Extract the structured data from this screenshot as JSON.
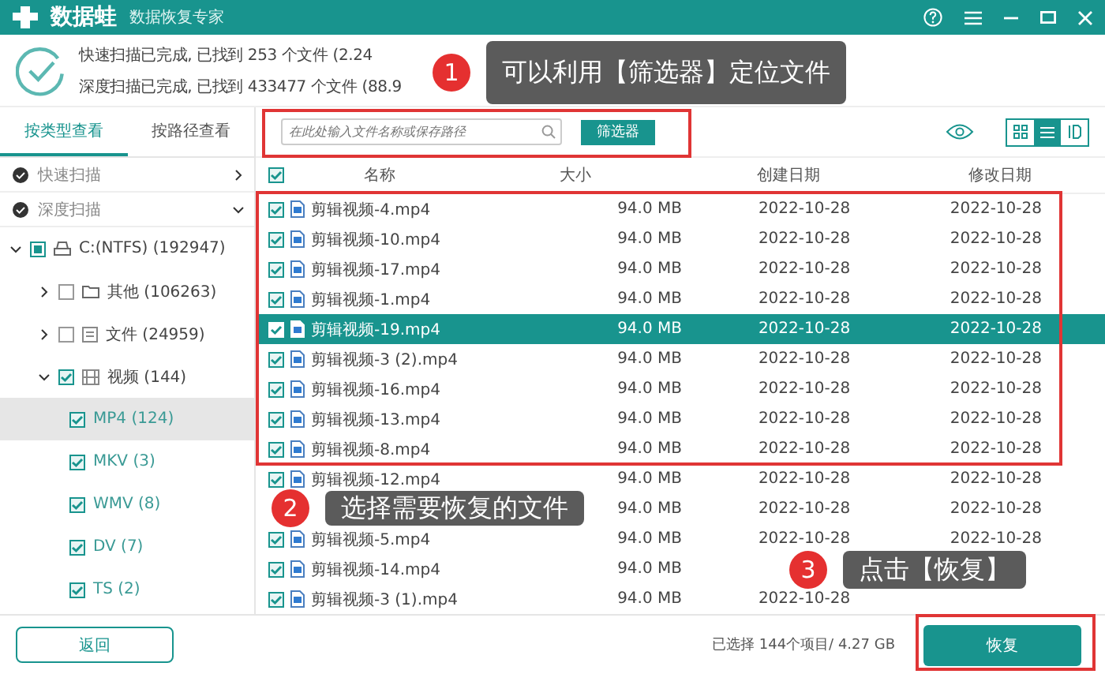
{
  "app": {
    "name": "数据蛙",
    "subtitle": "数据恢复专家"
  },
  "summary": [
    "快速扫描已完成, 已找到 253 个文件 (2.24",
    "深度扫描已完成, 已找到 433477 个文件 (88.9"
  ],
  "view_tabs": [
    {
      "label": "按类型查看",
      "selected": true
    },
    {
      "label": "按路径查看",
      "selected": false
    }
  ],
  "scans": [
    {
      "label": "快速扫描",
      "expanded": false
    },
    {
      "label": "深度扫描",
      "expanded": true
    }
  ],
  "tree": [
    {
      "label": "C:(NTFS) (192947)",
      "kind": "drive",
      "checked": false,
      "partial": true,
      "expanded": true,
      "selected": false,
      "children": [
        {
          "label": "其他 (106263)",
          "kind": "folder",
          "checked": false,
          "expanded": false,
          "selected": false
        },
        {
          "label": "文件 (24959)",
          "kind": "doc",
          "checked": false,
          "expanded": false,
          "selected": false
        },
        {
          "label": "视频 (144)",
          "kind": "video",
          "checked": true,
          "expanded": true,
          "selected": false,
          "children": [
            {
              "label": "MP4 (124)",
              "kind": "leaf",
              "checked": true,
              "selected": true
            },
            {
              "label": "MKV (3)",
              "kind": "leaf",
              "checked": true,
              "selected": false
            },
            {
              "label": "WMV (8)",
              "kind": "leaf",
              "checked": true,
              "selected": false
            },
            {
              "label": "DV (7)",
              "kind": "leaf",
              "checked": true,
              "selected": false
            },
            {
              "label": "TS (2)",
              "kind": "leaf",
              "checked": true,
              "selected": false
            }
          ]
        }
      ]
    }
  ],
  "search": {
    "placeholder": "在此处输入文件名称或保存路径"
  },
  "filter_button": "筛选器",
  "layout_modes": [
    {
      "kind": "grid",
      "selected": false
    },
    {
      "kind": "list",
      "selected": true
    },
    {
      "kind": "detail",
      "selected": false
    }
  ],
  "table": {
    "all_checked": true,
    "columns": [
      "名称",
      "大小",
      "创建日期",
      "修改日期"
    ],
    "rows": [
      {
        "name": "剪辑视频-4.mp4",
        "size": "94.0 MB",
        "created": "2022-10-28",
        "modified": "2022-10-28",
        "checked": true,
        "selected": false
      },
      {
        "name": "剪辑视频-10.mp4",
        "size": "94.0 MB",
        "created": "2022-10-28",
        "modified": "2022-10-28",
        "checked": true,
        "selected": false
      },
      {
        "name": "剪辑视频-17.mp4",
        "size": "94.0 MB",
        "created": "2022-10-28",
        "modified": "2022-10-28",
        "checked": true,
        "selected": false
      },
      {
        "name": "剪辑视频-1.mp4",
        "size": "94.0 MB",
        "created": "2022-10-28",
        "modified": "2022-10-28",
        "checked": true,
        "selected": false
      },
      {
        "name": "剪辑视频-19.mp4",
        "size": "94.0 MB",
        "created": "2022-10-28",
        "modified": "2022-10-28",
        "checked": true,
        "selected": true
      },
      {
        "name": "剪辑视频-3 (2).mp4",
        "size": "94.0 MB",
        "created": "2022-10-28",
        "modified": "2022-10-28",
        "checked": true,
        "selected": false
      },
      {
        "name": "剪辑视频-16.mp4",
        "size": "94.0 MB",
        "created": "2022-10-28",
        "modified": "2022-10-28",
        "checked": true,
        "selected": false
      },
      {
        "name": "剪辑视频-13.mp4",
        "size": "94.0 MB",
        "created": "2022-10-28",
        "modified": "2022-10-28",
        "checked": true,
        "selected": false
      },
      {
        "name": "剪辑视频-8.mp4",
        "size": "94.0 MB",
        "created": "2022-10-28",
        "modified": "2022-10-28",
        "checked": true,
        "selected": false
      },
      {
        "name": "剪辑视频-12.mp4",
        "size": "94.0 MB",
        "created": "2022-10-28",
        "modified": "2022-10-28",
        "checked": true,
        "selected": false
      },
      {
        "size": "94.0 MB",
        "created": "2022-10-28",
        "modified": "2022-10-28",
        "selected": false
      },
      {
        "name": "剪辑视频-5.mp4",
        "size": "94.0 MB",
        "created": "2022-10-28",
        "modified": "2022-10-28",
        "checked": true,
        "selected": false
      },
      {
        "name": "剪辑视频-14.mp4",
        "size": "94.0 MB",
        "checked": true,
        "selected": false
      },
      {
        "name": "剪辑视频-3 (1).mp4",
        "size": "94.0 MB",
        "created": "2022-10-28",
        "checked": true,
        "selected": false
      }
    ]
  },
  "back_button": "返回",
  "selection_info": "已选择 144个项目/ 4.27 GB",
  "recover_button": "恢复",
  "callouts": [
    {
      "number": "1",
      "text": "可以利用【筛选器】定位文件"
    },
    {
      "number": "2",
      "text": "选择需要恢复的文件"
    },
    {
      "number": "3",
      "text": "点击【恢复】"
    }
  ]
}
